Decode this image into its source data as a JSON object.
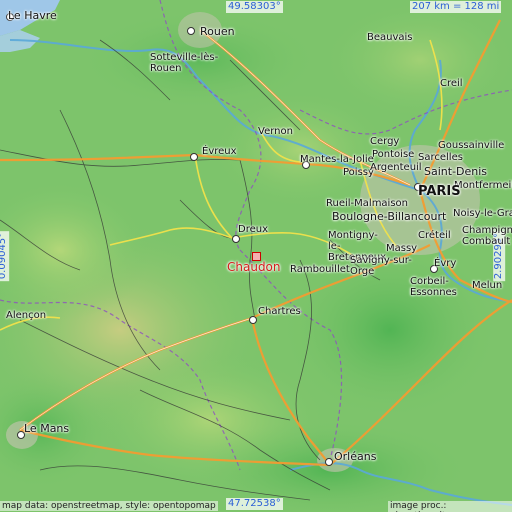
{
  "map": {
    "coords": {
      "top": "49.58303°",
      "bottom": "47.72538°",
      "left": "0.09045°",
      "right": "2.90295°"
    },
    "scale": "207 km = 128 mi",
    "credit_left": "map data: openstreetmap, style: opentopomap",
    "credit_right": "image proc.: elevation.city",
    "target": "Chaudon",
    "cities": {
      "le_havre": "Le Havre",
      "rouen": "Rouen",
      "sotteville": "Sotteville-lès-Rouen",
      "beauvais": "Beauvais",
      "creil": "Creil",
      "vernon": "Vernon",
      "evreux": "Évreux",
      "cergy": "Cergy",
      "goussainville": "Goussainville",
      "pontoise": "Pontoise",
      "sarcelles": "Sarcelles",
      "mantes": "Mantes-la-Jolie",
      "poissy": "Poissy",
      "argenteuil": "Argenteuil",
      "saint_denis": "Saint-Denis",
      "montfermeil": "Montfermeil",
      "paris": "PARIS",
      "rueil": "Rueil-Malmaison",
      "boulogne": "Boulogne-Billancourt",
      "noisy": "Noisy-le-Gra",
      "montigny": "Montigny-le-Bretonneux",
      "creteil": "Créteil",
      "massy": "Massy",
      "champigny": "Champigny",
      "combault": "Combault",
      "dreux": "Dreux",
      "savigny": "Savigny-sur-Orge",
      "evry": "Évry",
      "rambouillet": "Rambouillet",
      "corbeil": "Corbeil-Essonnes",
      "melun": "Melun",
      "chartres": "Chartres",
      "alencon": "Alençon",
      "le_mans": "Le Mans",
      "orleans": "Orléans"
    }
  }
}
